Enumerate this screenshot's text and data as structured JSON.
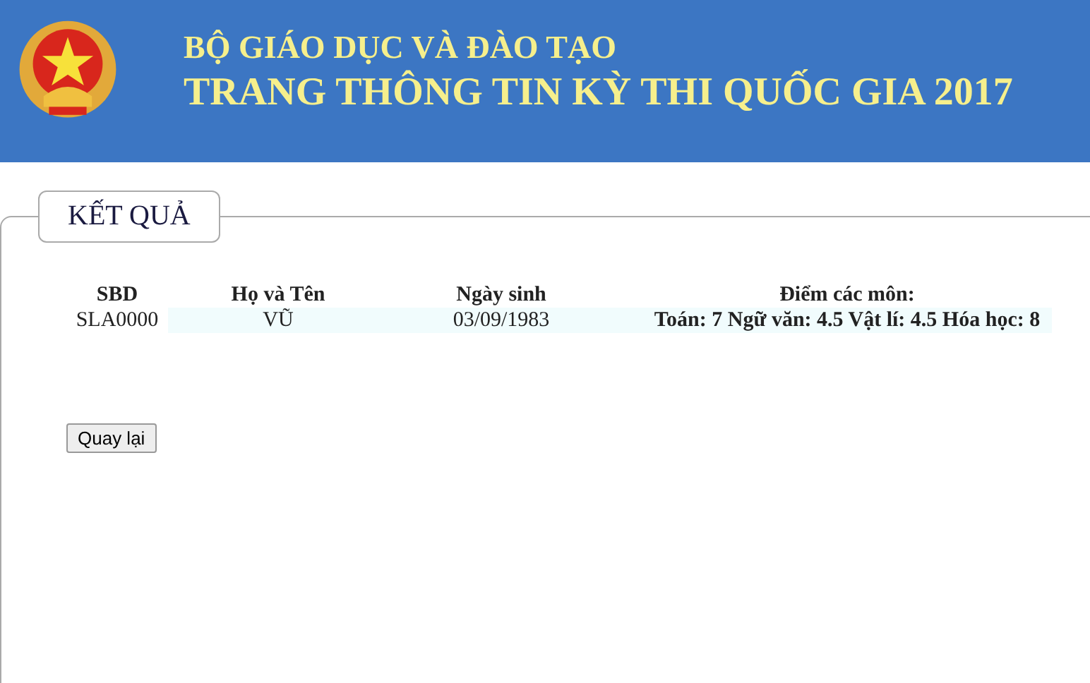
{
  "header": {
    "subtitle": "BỘ GIÁO DỤC VÀ ĐÀO TẠO",
    "title": "TRANG THÔNG TIN KỲ THI QUỐC GIA 2017"
  },
  "result": {
    "legend": "KẾT QUẢ",
    "table": {
      "columns": [
        "SBD",
        "Họ và Tên",
        "Ngày sinh",
        "Điểm các môn:"
      ],
      "rows": [
        [
          "SLA0000",
          "VŨ",
          "03/09/1983",
          "Toán: 7 Ngữ văn: 4.5 Vật lí: 4.5 Hóa học: 8"
        ]
      ]
    },
    "button": "Quay lại"
  }
}
